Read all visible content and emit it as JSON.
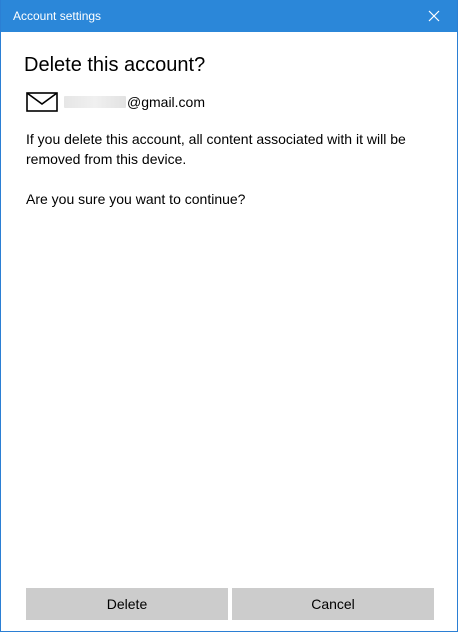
{
  "window": {
    "title": "Account settings",
    "accent_color": "#2b87d9"
  },
  "dialog": {
    "heading": "Delete this account?",
    "email_domain": "@gmail.com",
    "message": "If you delete this account, all content associated with it will be removed from this device.",
    "question": "Are you sure you want to continue?"
  },
  "buttons": {
    "delete_label": "Delete",
    "cancel_label": "Cancel",
    "button_color": "#cccccc"
  },
  "icons": {
    "close": "close-icon",
    "mail": "mail-icon"
  }
}
